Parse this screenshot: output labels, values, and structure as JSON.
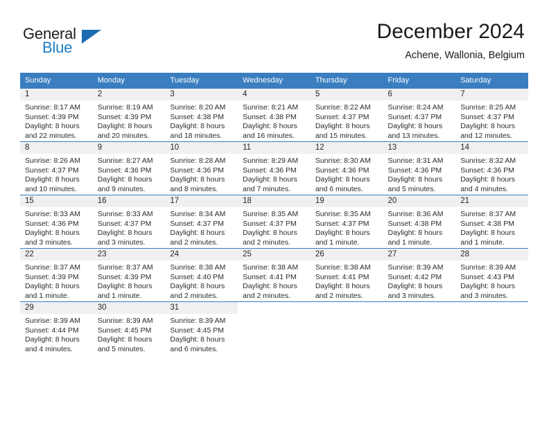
{
  "brand": {
    "name_part1": "General",
    "name_part2": "Blue",
    "triangle_icon": "triangle-icon",
    "colors": {
      "dark": "#1b1b1b",
      "blue": "#1d7ec4",
      "triangle": "#1b6cb0"
    }
  },
  "header": {
    "title": "December 2024",
    "subtitle": "Achene, Wallonia, Belgium"
  },
  "theme": {
    "header_row_bg": "#3a7ec0",
    "header_row_text": "#ffffff",
    "daynum_band_bg": "#f0f0f0",
    "cell_bg": "#ffffff",
    "row_divider": "#3a7ec0"
  },
  "weekdays": [
    "Sunday",
    "Monday",
    "Tuesday",
    "Wednesday",
    "Thursday",
    "Friday",
    "Saturday"
  ],
  "weeks": [
    [
      {
        "day": "1",
        "sunrise": "Sunrise: 8:17 AM",
        "sunset": "Sunset: 4:39 PM",
        "daylight_l1": "Daylight: 8 hours",
        "daylight_l2": "and 22 minutes."
      },
      {
        "day": "2",
        "sunrise": "Sunrise: 8:19 AM",
        "sunset": "Sunset: 4:39 PM",
        "daylight_l1": "Daylight: 8 hours",
        "daylight_l2": "and 20 minutes."
      },
      {
        "day": "3",
        "sunrise": "Sunrise: 8:20 AM",
        "sunset": "Sunset: 4:38 PM",
        "daylight_l1": "Daylight: 8 hours",
        "daylight_l2": "and 18 minutes."
      },
      {
        "day": "4",
        "sunrise": "Sunrise: 8:21 AM",
        "sunset": "Sunset: 4:38 PM",
        "daylight_l1": "Daylight: 8 hours",
        "daylight_l2": "and 16 minutes."
      },
      {
        "day": "5",
        "sunrise": "Sunrise: 8:22 AM",
        "sunset": "Sunset: 4:37 PM",
        "daylight_l1": "Daylight: 8 hours",
        "daylight_l2": "and 15 minutes."
      },
      {
        "day": "6",
        "sunrise": "Sunrise: 8:24 AM",
        "sunset": "Sunset: 4:37 PM",
        "daylight_l1": "Daylight: 8 hours",
        "daylight_l2": "and 13 minutes."
      },
      {
        "day": "7",
        "sunrise": "Sunrise: 8:25 AM",
        "sunset": "Sunset: 4:37 PM",
        "daylight_l1": "Daylight: 8 hours",
        "daylight_l2": "and 12 minutes."
      }
    ],
    [
      {
        "day": "8",
        "sunrise": "Sunrise: 8:26 AM",
        "sunset": "Sunset: 4:37 PM",
        "daylight_l1": "Daylight: 8 hours",
        "daylight_l2": "and 10 minutes."
      },
      {
        "day": "9",
        "sunrise": "Sunrise: 8:27 AM",
        "sunset": "Sunset: 4:36 PM",
        "daylight_l1": "Daylight: 8 hours",
        "daylight_l2": "and 9 minutes."
      },
      {
        "day": "10",
        "sunrise": "Sunrise: 8:28 AM",
        "sunset": "Sunset: 4:36 PM",
        "daylight_l1": "Daylight: 8 hours",
        "daylight_l2": "and 8 minutes."
      },
      {
        "day": "11",
        "sunrise": "Sunrise: 8:29 AM",
        "sunset": "Sunset: 4:36 PM",
        "daylight_l1": "Daylight: 8 hours",
        "daylight_l2": "and 7 minutes."
      },
      {
        "day": "12",
        "sunrise": "Sunrise: 8:30 AM",
        "sunset": "Sunset: 4:36 PM",
        "daylight_l1": "Daylight: 8 hours",
        "daylight_l2": "and 6 minutes."
      },
      {
        "day": "13",
        "sunrise": "Sunrise: 8:31 AM",
        "sunset": "Sunset: 4:36 PM",
        "daylight_l1": "Daylight: 8 hours",
        "daylight_l2": "and 5 minutes."
      },
      {
        "day": "14",
        "sunrise": "Sunrise: 8:32 AM",
        "sunset": "Sunset: 4:36 PM",
        "daylight_l1": "Daylight: 8 hours",
        "daylight_l2": "and 4 minutes."
      }
    ],
    [
      {
        "day": "15",
        "sunrise": "Sunrise: 8:33 AM",
        "sunset": "Sunset: 4:36 PM",
        "daylight_l1": "Daylight: 8 hours",
        "daylight_l2": "and 3 minutes."
      },
      {
        "day": "16",
        "sunrise": "Sunrise: 8:33 AM",
        "sunset": "Sunset: 4:37 PM",
        "daylight_l1": "Daylight: 8 hours",
        "daylight_l2": "and 3 minutes."
      },
      {
        "day": "17",
        "sunrise": "Sunrise: 8:34 AM",
        "sunset": "Sunset: 4:37 PM",
        "daylight_l1": "Daylight: 8 hours",
        "daylight_l2": "and 2 minutes."
      },
      {
        "day": "18",
        "sunrise": "Sunrise: 8:35 AM",
        "sunset": "Sunset: 4:37 PM",
        "daylight_l1": "Daylight: 8 hours",
        "daylight_l2": "and 2 minutes."
      },
      {
        "day": "19",
        "sunrise": "Sunrise: 8:35 AM",
        "sunset": "Sunset: 4:37 PM",
        "daylight_l1": "Daylight: 8 hours",
        "daylight_l2": "and 1 minute."
      },
      {
        "day": "20",
        "sunrise": "Sunrise: 8:36 AM",
        "sunset": "Sunset: 4:38 PM",
        "daylight_l1": "Daylight: 8 hours",
        "daylight_l2": "and 1 minute."
      },
      {
        "day": "21",
        "sunrise": "Sunrise: 8:37 AM",
        "sunset": "Sunset: 4:38 PM",
        "daylight_l1": "Daylight: 8 hours",
        "daylight_l2": "and 1 minute."
      }
    ],
    [
      {
        "day": "22",
        "sunrise": "Sunrise: 8:37 AM",
        "sunset": "Sunset: 4:39 PM",
        "daylight_l1": "Daylight: 8 hours",
        "daylight_l2": "and 1 minute."
      },
      {
        "day": "23",
        "sunrise": "Sunrise: 8:37 AM",
        "sunset": "Sunset: 4:39 PM",
        "daylight_l1": "Daylight: 8 hours",
        "daylight_l2": "and 1 minute."
      },
      {
        "day": "24",
        "sunrise": "Sunrise: 8:38 AM",
        "sunset": "Sunset: 4:40 PM",
        "daylight_l1": "Daylight: 8 hours",
        "daylight_l2": "and 2 minutes."
      },
      {
        "day": "25",
        "sunrise": "Sunrise: 8:38 AM",
        "sunset": "Sunset: 4:41 PM",
        "daylight_l1": "Daylight: 8 hours",
        "daylight_l2": "and 2 minutes."
      },
      {
        "day": "26",
        "sunrise": "Sunrise: 8:38 AM",
        "sunset": "Sunset: 4:41 PM",
        "daylight_l1": "Daylight: 8 hours",
        "daylight_l2": "and 2 minutes."
      },
      {
        "day": "27",
        "sunrise": "Sunrise: 8:39 AM",
        "sunset": "Sunset: 4:42 PM",
        "daylight_l1": "Daylight: 8 hours",
        "daylight_l2": "and 3 minutes."
      },
      {
        "day": "28",
        "sunrise": "Sunrise: 8:39 AM",
        "sunset": "Sunset: 4:43 PM",
        "daylight_l1": "Daylight: 8 hours",
        "daylight_l2": "and 3 minutes."
      }
    ],
    [
      {
        "day": "29",
        "sunrise": "Sunrise: 8:39 AM",
        "sunset": "Sunset: 4:44 PM",
        "daylight_l1": "Daylight: 8 hours",
        "daylight_l2": "and 4 minutes."
      },
      {
        "day": "30",
        "sunrise": "Sunrise: 8:39 AM",
        "sunset": "Sunset: 4:45 PM",
        "daylight_l1": "Daylight: 8 hours",
        "daylight_l2": "and 5 minutes."
      },
      {
        "day": "31",
        "sunrise": "Sunrise: 8:39 AM",
        "sunset": "Sunset: 4:45 PM",
        "daylight_l1": "Daylight: 8 hours",
        "daylight_l2": "and 6 minutes."
      },
      {
        "day": "",
        "sunrise": "",
        "sunset": "",
        "daylight_l1": "",
        "daylight_l2": ""
      },
      {
        "day": "",
        "sunrise": "",
        "sunset": "",
        "daylight_l1": "",
        "daylight_l2": ""
      },
      {
        "day": "",
        "sunrise": "",
        "sunset": "",
        "daylight_l1": "",
        "daylight_l2": ""
      },
      {
        "day": "",
        "sunrise": "",
        "sunset": "",
        "daylight_l1": "",
        "daylight_l2": ""
      }
    ]
  ]
}
